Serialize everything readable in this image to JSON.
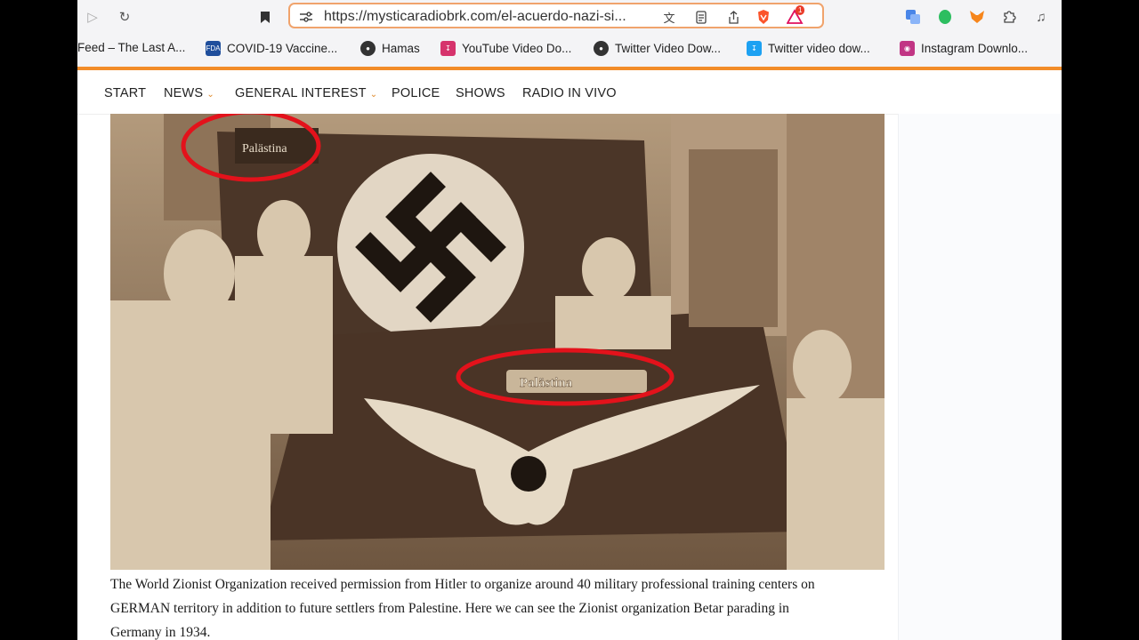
{
  "browser": {
    "url": "https://mysticaradiobrk.com/el-acuerdo-nazi-si...",
    "shields_badge": "1"
  },
  "bookmarks": [
    {
      "label": "Feed – The Last A...",
      "icon": "none"
    },
    {
      "label": "COVID-19 Vaccine...",
      "icon": "fda-icon",
      "icon_text": "FDA",
      "color": "#1f4e9c"
    },
    {
      "label": "Hamas",
      "icon": "globe-icon",
      "color": "#333333"
    },
    {
      "label": "YouTube Video Do...",
      "icon": "download-icon",
      "color": "#d6336c"
    },
    {
      "label": "Twitter Video Dow...",
      "icon": "globe-icon",
      "color": "#333333"
    },
    {
      "label": "Twitter video dow...",
      "icon": "download-icon",
      "color": "#1da1f2"
    },
    {
      "label": "Instagram Downlo...",
      "icon": "instagram-icon",
      "color": "#c13584"
    }
  ],
  "nav": [
    {
      "label": "START",
      "dropdown": false
    },
    {
      "label": "NEWS",
      "dropdown": true
    },
    {
      "label": "GENERAL INTEREST",
      "dropdown": true
    },
    {
      "label": "POLICE",
      "dropdown": false
    },
    {
      "label": "SHOWS",
      "dropdown": false
    },
    {
      "label": "RADIO IN VIVO",
      "dropdown": false
    }
  ],
  "photo": {
    "top_banner_text": "Palästina",
    "flag_banner_text": "Palästina"
  },
  "article": {
    "caption_lines": [
      "The World Zionist Organization received permission from Hitler to organize around 40 military professional training centers on",
      "GERMAN territory in addition to future settlers from Palestine. Here we can see the Zionist organization Betar parading in",
      "Germany in 1934."
    ]
  },
  "colors": {
    "accent": "#f28c28",
    "url_border": "#f0a36c",
    "annotation_red": "#e3121b"
  }
}
